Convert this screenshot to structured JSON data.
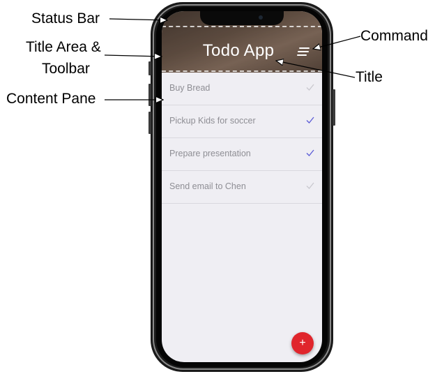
{
  "callouts": {
    "status_bar": "Status Bar",
    "title_area_line1": "Title Area &",
    "title_area_line2": "Toolbar",
    "content_pane": "Content Pane",
    "command": "Command",
    "title": "Title"
  },
  "app": {
    "title": "Todo App",
    "menu_icon": "hamburger-menu-icon",
    "fab_label": "+",
    "accent_color": "#e0252c",
    "check_done_color": "#5b5bd6",
    "check_todo_color": "#c9c8ce"
  },
  "todos": [
    {
      "label": "Buy Bread",
      "done": false
    },
    {
      "label": "Pickup Kids for soccer",
      "done": true
    },
    {
      "label": "Prepare presentation",
      "done": true
    },
    {
      "label": "Send email to Chen",
      "done": false
    }
  ]
}
